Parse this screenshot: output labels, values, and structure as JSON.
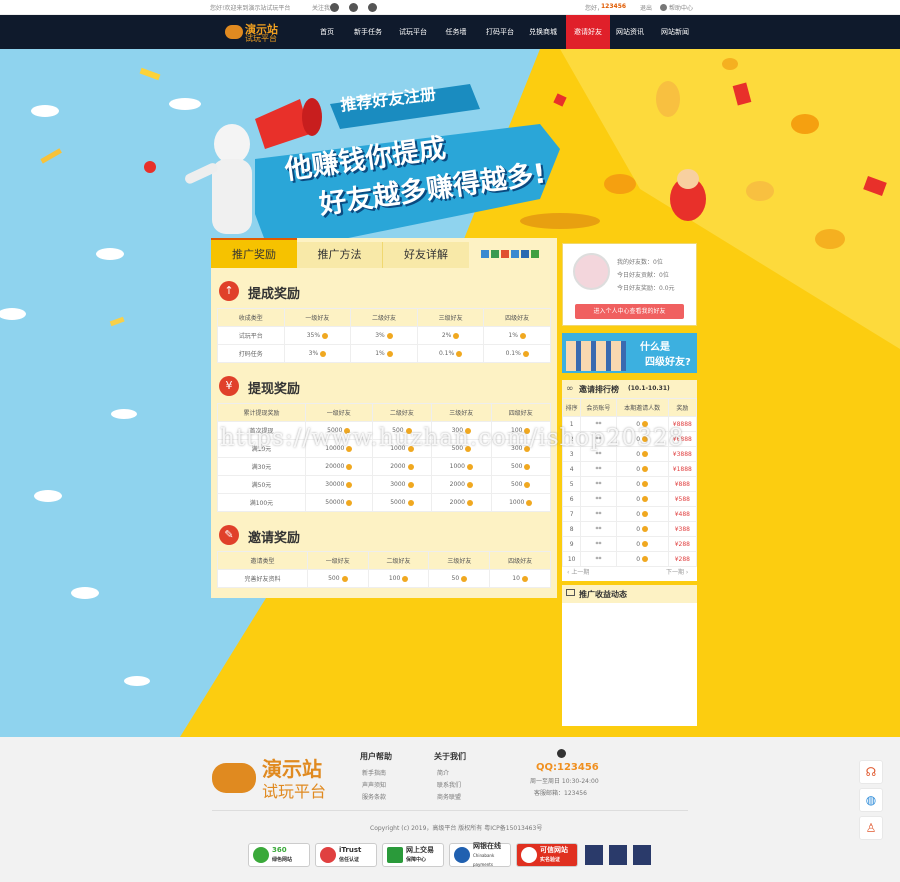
{
  "topbar": {
    "welcome": "您好!欢迎来到演示站试玩平台",
    "follow_label": "关注我们：",
    "user_label": "您好，",
    "user_id": "123456",
    "logout": "退出",
    "help": "帮助中心"
  },
  "nav": {
    "logo_title": "演示站",
    "logo_sub": "试玩平台",
    "items": [
      {
        "label": "首页",
        "active": false
      },
      {
        "label": "新手任务",
        "active": false
      },
      {
        "label": "试玩平台",
        "active": false
      },
      {
        "label": "任务墙",
        "active": false
      },
      {
        "label": "打码平台",
        "active": false
      },
      {
        "label": "兑换商城",
        "active": false
      },
      {
        "label": "邀请好友",
        "active": true
      },
      {
        "label": "网站资讯",
        "active": false
      },
      {
        "label": "网站新闻",
        "active": false
      }
    ]
  },
  "hero": {
    "banner_ribbon": "推荐好友注册",
    "headline_1": "他赚钱你提成",
    "headline_2": "好友越多赚得越多!",
    "colors": {
      "sky": "#8fd3ee",
      "yellow": "#fccd10",
      "accent": "#e0202a"
    }
  },
  "tabs": [
    {
      "label": "推广奖励",
      "active": true
    },
    {
      "label": "推广方法",
      "active": false
    },
    {
      "label": "好友详解",
      "active": false
    }
  ],
  "sections": {
    "commission": {
      "title": "提成奖励",
      "headers": [
        "收成类型",
        "一级好友",
        "二级好友",
        "三级好友",
        "四级好友"
      ],
      "rows": [
        [
          "试玩平台",
          "35%",
          "3%",
          "2%",
          "1%"
        ],
        [
          "打码任务",
          "3%",
          "1%",
          "0.1%",
          "0.1%"
        ]
      ]
    },
    "withdraw": {
      "title": "提现奖励",
      "headers": [
        "累计提现奖励",
        "一级好友",
        "二级好友",
        "三级好友",
        "四级好友"
      ],
      "rows": [
        [
          "首次提现",
          "5000",
          "500",
          "300",
          "100"
        ],
        [
          "满10元",
          "10000",
          "1000",
          "500",
          "300"
        ],
        [
          "满30元",
          "20000",
          "2000",
          "1000",
          "500"
        ],
        [
          "满50元",
          "30000",
          "3000",
          "2000",
          "500"
        ],
        [
          "满100元",
          "50000",
          "5000",
          "2000",
          "1000"
        ]
      ]
    },
    "invite": {
      "title": "邀请奖励",
      "headers": [
        "邀请类型",
        "一级好友",
        "二级好友",
        "三级好友",
        "四级好友"
      ],
      "rows": [
        [
          "完善好友资料",
          "500",
          "100",
          "50",
          "10"
        ]
      ]
    }
  },
  "profile": {
    "stats": [
      "我的好友数：0位",
      "今日好友贡献：0位",
      "今日好友奖励：0.0元"
    ],
    "enter_button": "进入个人中心查看我的好友"
  },
  "promo_banner": {
    "line1": "什么是",
    "line2": "四级好友?"
  },
  "ranking": {
    "title": "邀请排行榜",
    "period": "(10.1-10.31)",
    "headers": [
      "排序",
      "会员账号",
      "本期邀请人数",
      "奖励"
    ],
    "rows": [
      [
        "1",
        "**",
        "0",
        "¥8888"
      ],
      [
        "2",
        "**",
        "0",
        "¥6888"
      ],
      [
        "3",
        "**",
        "0",
        "¥3888"
      ],
      [
        "4",
        "**",
        "0",
        "¥1888"
      ],
      [
        "5",
        "**",
        "0",
        "¥888"
      ],
      [
        "6",
        "**",
        "0",
        "¥588"
      ],
      [
        "7",
        "**",
        "0",
        "¥488"
      ],
      [
        "8",
        "**",
        "0",
        "¥388"
      ],
      [
        "9",
        "**",
        "0",
        "¥288"
      ],
      [
        "10",
        "**",
        "0",
        "¥288"
      ]
    ],
    "prev": "上一期",
    "next": "下一期"
  },
  "news": {
    "title": "推广收益动态"
  },
  "watermark": "https://www.huzhan.com/ishop20328",
  "footer": {
    "logo_title": "演示站",
    "logo_sub": "试玩平台",
    "col1_title": "用户帮助",
    "col1_links": [
      "新手指南",
      "声声须知",
      "服务条款"
    ],
    "col2_title": "关于我们",
    "col2_links": [
      "简介",
      "联系我们",
      "商务联盟"
    ],
    "qq": "QQ:123456",
    "hours": "周一至周日 10:30-24:00",
    "email": "客服邮箱：123456",
    "copyright": "Copyright (c) 2019，高级平台 版权所有 粤ICP备15013463号",
    "badges": [
      {
        "l1": "360",
        "l2": "绿色网站",
        "color": "#3aa93a"
      },
      {
        "l1": "iTrust",
        "l2": "信任认证",
        "color": "#e04040"
      },
      {
        "l1": "网上交易",
        "l2": "保障中心",
        "color": "#2a9a3a"
      },
      {
        "l1": "网银在线",
        "l2": "Chinabank payments",
        "color": "#2060b0"
      },
      {
        "l1": "可信网站",
        "l2": "实名验证",
        "color": "#e03020"
      }
    ]
  }
}
